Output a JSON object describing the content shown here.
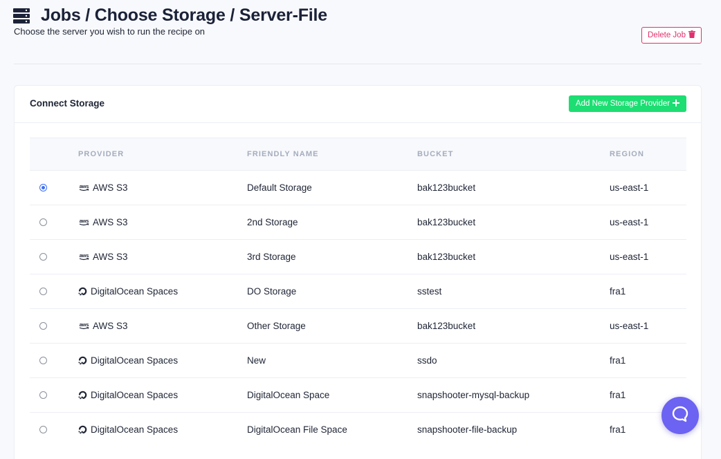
{
  "header": {
    "icon": "server-stack-icon",
    "title": "Jobs / Choose Storage / Server-File",
    "subtitle": "Choose the server you wish to run the recipe on",
    "delete_label": "Delete Job",
    "delete_icon": "trash-icon",
    "delete_color": "#e0306d"
  },
  "card": {
    "title": "Connect Storage",
    "add_label": "Add New Storage Provider",
    "add_icon": "plus-icon",
    "add_color": "#1cde72"
  },
  "table": {
    "columns": [
      "PROVIDER",
      "FRIENDLY NAME",
      "BUCKET",
      "REGION"
    ],
    "rows": [
      {
        "selected": true,
        "provider": "AWS S3",
        "provider_icon": "aws-logo-icon",
        "name": "Default Storage",
        "bucket": "bak123bucket",
        "region": "us-east-1"
      },
      {
        "selected": false,
        "provider": "AWS S3",
        "provider_icon": "aws-logo-icon",
        "name": "2nd Storage",
        "bucket": "bak123bucket",
        "region": "us-east-1"
      },
      {
        "selected": false,
        "provider": "AWS S3",
        "provider_icon": "aws-logo-icon",
        "name": "3rd Storage",
        "bucket": "bak123bucket",
        "region": "us-east-1"
      },
      {
        "selected": false,
        "provider": "DigitalOcean Spaces",
        "provider_icon": "digitalocean-logo-icon",
        "name": "DO Storage",
        "bucket": "sstest",
        "region": "fra1"
      },
      {
        "selected": false,
        "provider": "AWS S3",
        "provider_icon": "aws-logo-icon",
        "name": "Other Storage",
        "bucket": "bak123bucket",
        "region": "us-east-1"
      },
      {
        "selected": false,
        "provider": "DigitalOcean Spaces",
        "provider_icon": "digitalocean-logo-icon",
        "name": "New",
        "bucket": "ssdo",
        "region": "fra1"
      },
      {
        "selected": false,
        "provider": "DigitalOcean Spaces",
        "provider_icon": "digitalocean-logo-icon",
        "name": "DigitalOcean Space",
        "bucket": "snapshooter-mysql-backup",
        "region": "fra1"
      },
      {
        "selected": false,
        "provider": "DigitalOcean Spaces",
        "provider_icon": "digitalocean-logo-icon",
        "name": "DigitalOcean File Space",
        "bucket": "snapshooter-file-backup",
        "region": "fra1"
      }
    ]
  },
  "chat": {
    "icon": "chat-bubble-icon",
    "color": "#6c63f2"
  },
  "colors": {
    "accent_radio": "#3b6ef5",
    "text": "#1e2434",
    "header_muted": "#a4acbe"
  }
}
